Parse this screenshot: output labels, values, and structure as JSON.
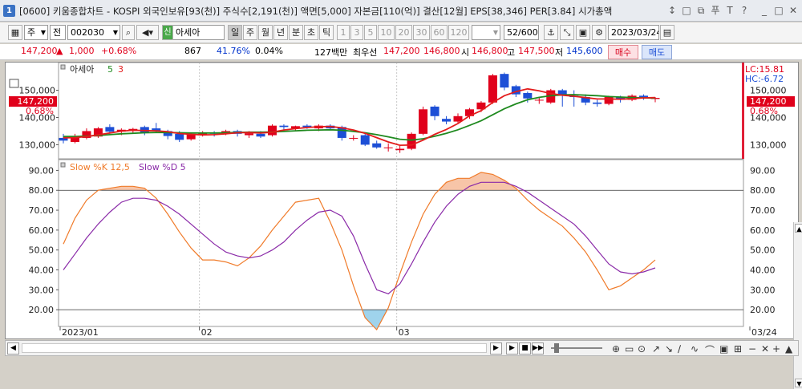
{
  "window": {
    "number": "1",
    "title": "[0600] 키움종합차트 - KOSPI 외국인보유[93(천)] 주식수[2,191(천)] 액면[5,000] 자본금[110(억)] 결산[12월] EPS[38,346] PER[3.84] 시가총액",
    "controls": [
      "↕",
      "□",
      "⧉",
      "푸",
      "T",
      "?",
      "_",
      "□",
      "✕"
    ]
  },
  "toolbar": {
    "period_select": "주",
    "market_select": "전",
    "stock_code": "002030",
    "stock_name": "아세아",
    "credit_badge": "신",
    "period_buttons": [
      "일",
      "주",
      "월",
      "년",
      "분",
      "초",
      "틱"
    ],
    "interval_buttons": [
      "1",
      "3",
      "5",
      "10",
      "20",
      "30",
      "60",
      "120"
    ],
    "count": "52",
    "count_max": "/600",
    "date": "2023/03/24"
  },
  "quote": {
    "price": "147,200",
    "change_arrow": "▲",
    "change": "1,000",
    "change_pct": "+0.68%",
    "volume": "867",
    "vol_ratio": "41.76%",
    "turnover": "0.04%",
    "amount": "127백만",
    "best_label": "최우선",
    "ask": "147,200",
    "bid": "146,800",
    "open_label": "시",
    "open": "146,800",
    "high_label": "고",
    "high": "147,500",
    "low_label": "저",
    "low": "145,600",
    "buy_label": "매수",
    "sell_label": "매도"
  },
  "price_panel": {
    "indicator_name": "아세아",
    "ma_periods": [
      "5",
      "3"
    ],
    "lc_label": "LC:15.81",
    "hc_label": "HC:-6.72",
    "current_price": "147,200",
    "current_change": "0.68%",
    "y_ticks": [
      "150,000",
      "140,000",
      "130,000"
    ]
  },
  "stoch_panel": {
    "k_label": "Slow %K 12,5",
    "d_label": "Slow %D 5",
    "y_ticks": [
      "90.00",
      "80.00",
      "70.00",
      "60.00",
      "50.00",
      "40.00",
      "30.00",
      "20.00"
    ]
  },
  "x_axis": {
    "labels": [
      "2023/01",
      "02",
      "03",
      "03/24"
    ]
  },
  "colors": {
    "up": "#e0001b",
    "down": "#1d4fd6",
    "ma_short": "#e31c1c",
    "ma_long": "#1f8a1f",
    "slow_k": "#f07b2a",
    "slow_d": "#8a2aa8"
  },
  "chart_data": [
    {
      "type": "candlestick",
      "title": "아세아",
      "y_ticks": [
        130000,
        140000,
        150000
      ],
      "ylim": [
        126000,
        159000
      ],
      "candles": [
        {
          "o": 132500,
          "h": 134000,
          "l": 130500,
          "c": 131500
        },
        {
          "o": 131000,
          "h": 134000,
          "l": 130500,
          "c": 133000
        },
        {
          "o": 132500,
          "h": 136000,
          "l": 132000,
          "c": 135000
        },
        {
          "o": 133000,
          "h": 136500,
          "l": 132500,
          "c": 136000
        },
        {
          "o": 136500,
          "h": 137500,
          "l": 134000,
          "c": 134800
        },
        {
          "o": 134800,
          "h": 136000,
          "l": 133500,
          "c": 135500
        },
        {
          "o": 135000,
          "h": 136200,
          "l": 134000,
          "c": 135800
        },
        {
          "o": 136500,
          "h": 137000,
          "l": 133500,
          "c": 134500
        },
        {
          "o": 136000,
          "h": 138000,
          "l": 134500,
          "c": 135000
        },
        {
          "o": 135000,
          "h": 135500,
          "l": 132000,
          "c": 133200
        },
        {
          "o": 134000,
          "h": 135000,
          "l": 131000,
          "c": 131800
        },
        {
          "o": 132000,
          "h": 134500,
          "l": 131500,
          "c": 134000
        },
        {
          "o": 133500,
          "h": 135000,
          "l": 133000,
          "c": 134500
        },
        {
          "o": 134500,
          "h": 135000,
          "l": 133000,
          "c": 134000
        },
        {
          "o": 134000,
          "h": 135500,
          "l": 133500,
          "c": 135000
        },
        {
          "o": 135000,
          "h": 135500,
          "l": 133000,
          "c": 134000
        },
        {
          "o": 133500,
          "h": 135000,
          "l": 132500,
          "c": 134200
        },
        {
          "o": 134000,
          "h": 135000,
          "l": 132500,
          "c": 133000
        },
        {
          "o": 133500,
          "h": 137500,
          "l": 133000,
          "c": 137000
        },
        {
          "o": 137000,
          "h": 137500,
          "l": 135500,
          "c": 136500
        },
        {
          "o": 136000,
          "h": 137000,
          "l": 135000,
          "c": 136800
        },
        {
          "o": 137000,
          "h": 137500,
          "l": 135800,
          "c": 136500
        },
        {
          "o": 136000,
          "h": 137500,
          "l": 135000,
          "c": 137000
        },
        {
          "o": 137000,
          "h": 137500,
          "l": 135500,
          "c": 136000
        },
        {
          "o": 136500,
          "h": 137000,
          "l": 131500,
          "c": 132500
        },
        {
          "o": 132500,
          "h": 133500,
          "l": 131500,
          "c": 132500
        },
        {
          "o": 133500,
          "h": 134500,
          "l": 129500,
          "c": 130000
        },
        {
          "o": 130500,
          "h": 131500,
          "l": 128500,
          "c": 129000
        },
        {
          "o": 129000,
          "h": 130500,
          "l": 127500,
          "c": 129000
        },
        {
          "o": 128000,
          "h": 130000,
          "l": 127000,
          "c": 128500
        },
        {
          "o": 128500,
          "h": 134500,
          "l": 128000,
          "c": 134000
        },
        {
          "o": 134000,
          "h": 144000,
          "l": 133500,
          "c": 143000
        },
        {
          "o": 144000,
          "h": 144500,
          "l": 139000,
          "c": 140500
        },
        {
          "o": 139500,
          "h": 140500,
          "l": 137500,
          "c": 138500
        },
        {
          "o": 138500,
          "h": 141500,
          "l": 138000,
          "c": 140500
        },
        {
          "o": 140500,
          "h": 143500,
          "l": 139500,
          "c": 143000
        },
        {
          "o": 143000,
          "h": 146000,
          "l": 142000,
          "c": 145500
        },
        {
          "o": 145500,
          "h": 156000,
          "l": 145000,
          "c": 155500
        },
        {
          "o": 156000,
          "h": 156500,
          "l": 150000,
          "c": 151000
        },
        {
          "o": 151500,
          "h": 152000,
          "l": 147500,
          "c": 148500
        },
        {
          "o": 149000,
          "h": 149500,
          "l": 145500,
          "c": 147000
        },
        {
          "o": 146500,
          "h": 147500,
          "l": 145000,
          "c": 146500
        },
        {
          "o": 145500,
          "h": 150500,
          "l": 145000,
          "c": 150000
        },
        {
          "o": 150000,
          "h": 150500,
          "l": 144000,
          "c": 148000
        },
        {
          "o": 148000,
          "h": 150000,
          "l": 144000,
          "c": 147500
        },
        {
          "o": 147500,
          "h": 148500,
          "l": 144500,
          "c": 145500
        },
        {
          "o": 145500,
          "h": 146500,
          "l": 144000,
          "c": 145000
        },
        {
          "o": 145000,
          "h": 148000,
          "l": 144500,
          "c": 147500
        },
        {
          "o": 147500,
          "h": 148000,
          "l": 145500,
          "c": 146500
        },
        {
          "o": 146500,
          "h": 148500,
          "l": 146000,
          "c": 148000
        },
        {
          "o": 148000,
          "h": 148500,
          "l": 146500,
          "c": 147000
        },
        {
          "o": 146800,
          "h": 147500,
          "l": 145600,
          "c": 147200
        }
      ],
      "ma5": [
        132500,
        132600,
        133000,
        133600,
        134300,
        135000,
        135300,
        135200,
        135100,
        134800,
        134100,
        133800,
        133600,
        133700,
        134000,
        134400,
        134500,
        134300,
        134600,
        135400,
        135900,
        136300,
        136600,
        136700,
        136200,
        135400,
        134200,
        132600,
        131000,
        129800,
        129900,
        131700,
        133800,
        135600,
        137800,
        140600,
        142500,
        145500,
        148000,
        149500,
        150500,
        149800,
        148800,
        148200,
        147800,
        147300,
        146800,
        146800,
        146700,
        146900,
        147200,
        147300
      ],
      "ma20": [
        133000,
        133000,
        133200,
        133400,
        133700,
        134000,
        134200,
        134400,
        134500,
        134500,
        134400,
        134300,
        134300,
        134300,
        134400,
        134500,
        134600,
        134600,
        134700,
        134900,
        135100,
        135300,
        135400,
        135500,
        135300,
        134900,
        134400,
        133700,
        132900,
        132000,
        131700,
        132200,
        133100,
        134200,
        135500,
        137100,
        138800,
        141000,
        143200,
        145000,
        146500,
        147400,
        148000,
        148300,
        148400,
        148200,
        148000,
        147700,
        147500,
        147300,
        147200,
        147100
      ]
    },
    {
      "type": "line",
      "title": "Slow %K 12,5 / Slow %D 5",
      "y_ticks": [
        20,
        30,
        40,
        50,
        60,
        70,
        80,
        90
      ],
      "ylim": [
        12,
        95
      ],
      "reference_lines": [
        80,
        20
      ],
      "series": [
        {
          "name": "Slow %K 12,5",
          "values": [
            53,
            66,
            75,
            80,
            81,
            82,
            82,
            81,
            76,
            68,
            59,
            51,
            45,
            45,
            44,
            42,
            46,
            52,
            60,
            67,
            74,
            75,
            76,
            64,
            50,
            32,
            16,
            10,
            21,
            38,
            54,
            68,
            78,
            84,
            86,
            86,
            89,
            88,
            85,
            81,
            75,
            70,
            66,
            62,
            56,
            49,
            40,
            30,
            32,
            36,
            40,
            45
          ]
        },
        {
          "name": "Slow %D 5",
          "values": [
            40,
            48,
            56,
            63,
            69,
            74,
            76,
            76,
            75,
            72,
            68,
            63,
            58,
            53,
            49,
            47,
            46,
            47,
            50,
            54,
            60,
            65,
            69,
            70,
            67,
            57,
            43,
            30,
            28,
            33,
            43,
            54,
            64,
            72,
            78,
            82,
            84,
            84,
            84,
            82,
            79,
            75,
            71,
            67,
            63,
            57,
            50,
            43,
            39,
            38,
            39,
            41
          ]
        }
      ]
    }
  ]
}
